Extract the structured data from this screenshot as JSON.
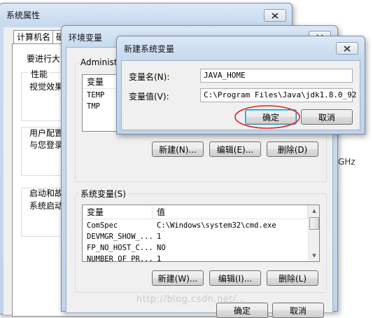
{
  "system_properties": {
    "title": "系统属性",
    "tabs": [
      "计算机名",
      "硬"
    ],
    "intro": "要进行大多",
    "performance_label": "性能",
    "performance_desc": "视觉效果",
    "user_profile_desc_1": "用户配置",
    "user_profile_desc_2": "与您登录",
    "startup_label": "启动和故障",
    "startup_desc": "系统启动",
    "ghz_fragment": "GHz"
  },
  "env_vars": {
    "title": "环境变量",
    "user_group_label": "Administ",
    "user_columns": [
      "变量"
    ],
    "user_rows": [
      {
        "name": "TEMP"
      },
      {
        "name": "TMP"
      }
    ],
    "user_new": "新建(N)...",
    "user_edit": "编辑(E)...",
    "user_delete": "删除(D)",
    "sys_group_label": "系统变量(S)",
    "sys_columns": [
      "变量",
      "值"
    ],
    "sys_rows": [
      {
        "name": "ComSpec",
        "value": "C:\\Windows\\system32\\cmd.exe"
      },
      {
        "name": "DEVMGR_SHOW_...",
        "value": "1"
      },
      {
        "name": "FP_NO_HOST_C...",
        "value": "NO"
      },
      {
        "name": "NUMBER_OF_PR...",
        "value": "1"
      }
    ],
    "sys_new": "新建(W)...",
    "sys_edit": "编辑(I)...",
    "sys_delete": "删除(L)",
    "ok": "确定",
    "cancel": "取消"
  },
  "new_var": {
    "title": "新建系统变量",
    "name_label": "变量名(N):",
    "name_value": "JAVA_HOME",
    "value_label": "变量值(V):",
    "value_value": "C:\\Program Files\\Java\\jdk1.8.0_92",
    "ok": "确定",
    "cancel": "取消"
  },
  "watermark": "http://blog.csdn.net/..."
}
